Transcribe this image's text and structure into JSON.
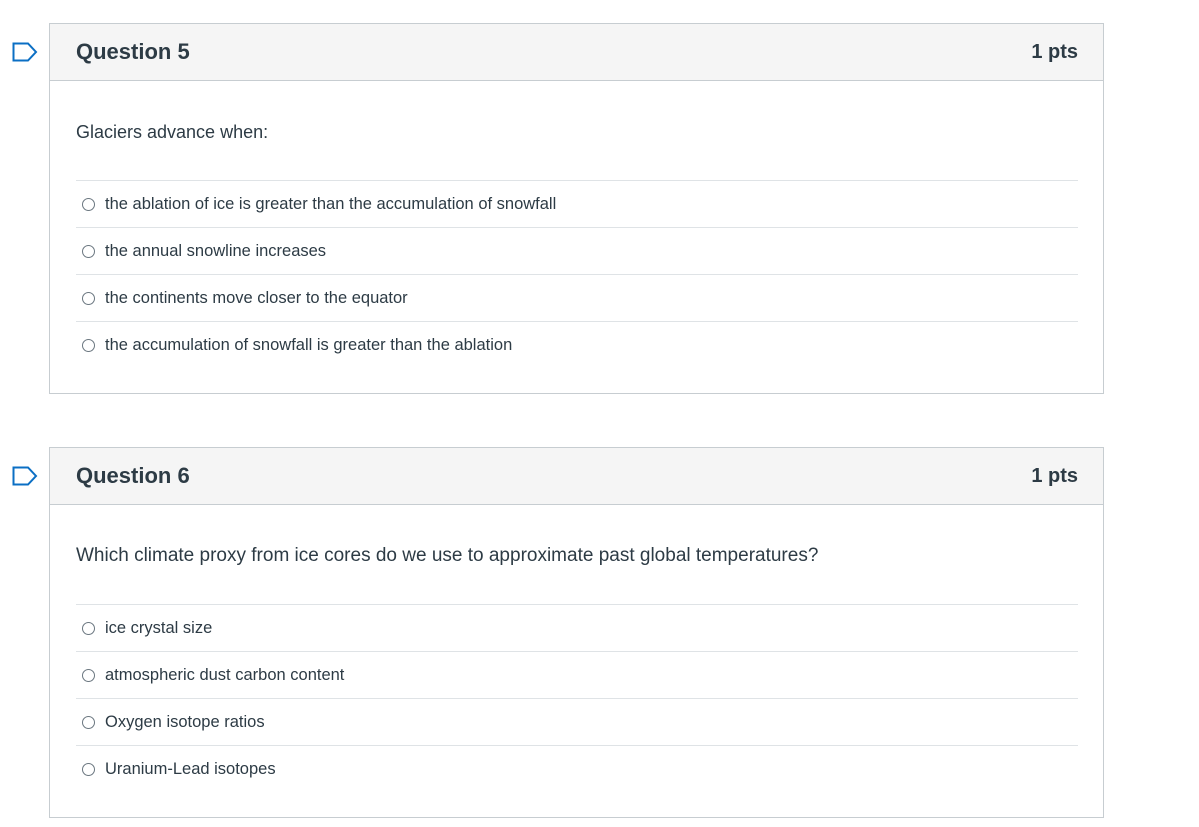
{
  "questions": [
    {
      "title": "Question 5",
      "points": "1 pts",
      "flag_icon": "bookmark-flag-icon",
      "text": "Glaciers advance when:",
      "answers": [
        "the ablation of ice is greater than the accumulation of snowfall",
        "the annual snowline increases",
        "the continents move closer to the equator",
        "the accumulation of snowfall is greater than the ablation"
      ]
    },
    {
      "title": "Question 6",
      "points": "1 pts",
      "flag_icon": "bookmark-flag-icon",
      "text": "Which climate proxy from ice cores do we use to approximate past global temperatures?",
      "answers": [
        "ice crystal size",
        "atmospheric dust carbon content",
        "Oxygen isotope ratios",
        "Uranium-Lead isotopes"
      ]
    }
  ],
  "colors": {
    "flag": "#0b6fc4",
    "header_bg": "#f5f5f5",
    "border": "#c7cdd1",
    "text": "#2d3b45"
  }
}
